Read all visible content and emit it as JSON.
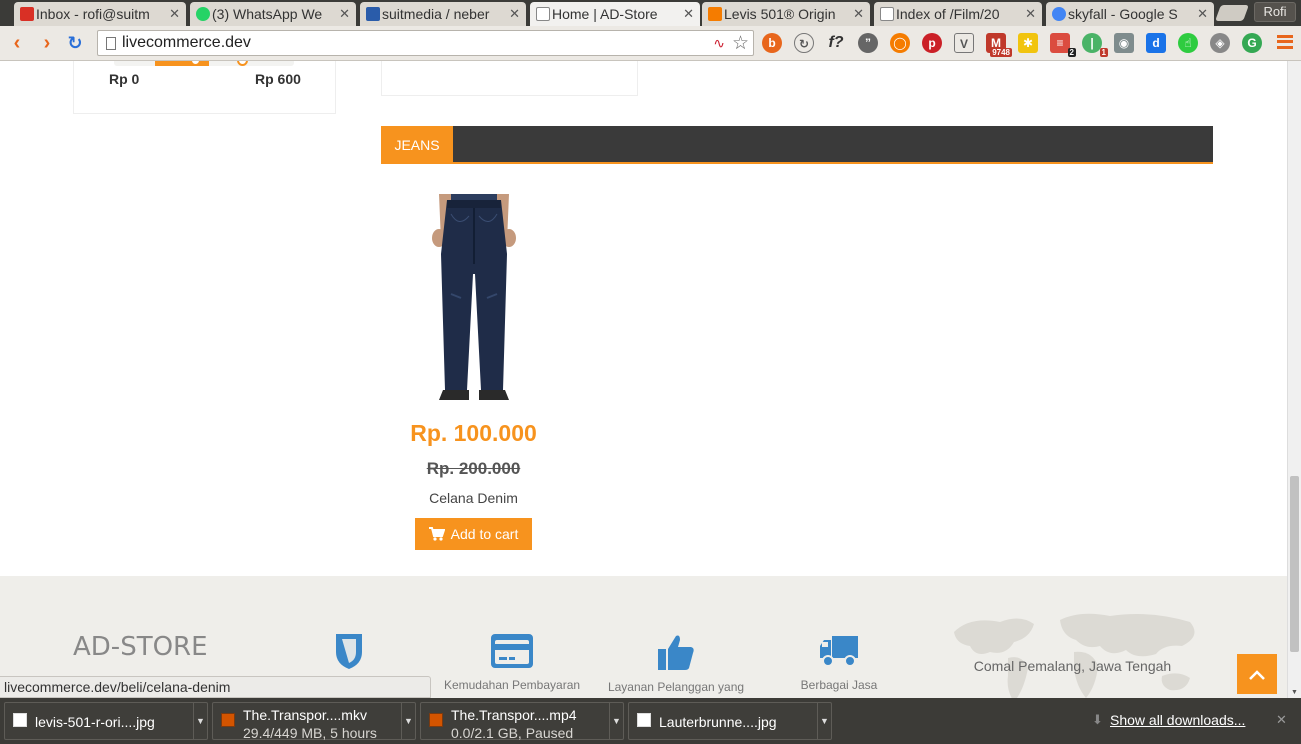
{
  "browser": {
    "tabs": [
      {
        "title": "Inbox - rofi@suitm",
        "favicon_color": "#d93025",
        "active": false
      },
      {
        "title": "(3) WhatsApp We",
        "favicon_color": "#25d366",
        "active": false
      },
      {
        "title": "suitmedia / neber",
        "favicon_color": "#2a5caa",
        "active": false
      },
      {
        "title": "Home | AD-Store",
        "favicon_color": "#cccccc",
        "active": true
      },
      {
        "title": "Levis 501® Origin",
        "favicon_color": "#f57c00",
        "active": false
      },
      {
        "title": "Index of /Film/20",
        "favicon_color": "#cccccc",
        "active": false
      },
      {
        "title": "skyfall - Google S",
        "favicon_color": "#4285f4",
        "active": false
      }
    ],
    "tab_close": "✕",
    "profile_name": "Rofi",
    "url": "livecommerce.dev",
    "extensions": [
      "lastpass-icon",
      "streak-icon",
      "formula-icon",
      "quote-icon",
      "firefox-icon",
      "pinterest-icon",
      "shield-icon",
      "gmail-checker-icon",
      "sticky-notes-icon",
      "todoist-icon",
      "pushbullet-icon",
      "camera-icon",
      "dictionary-icon",
      "hand-cursor-icon",
      "feedly-icon",
      "google-icon"
    ],
    "extension_badges": {
      "gmail": "9748",
      "todoist": "2",
      "pushbullet": "1"
    }
  },
  "page": {
    "price_filter": {
      "min_label": "Rp 0",
      "max_label": "Rp 600"
    },
    "category": {
      "label": "JEANS"
    },
    "product": {
      "price": "Rp. 100.000",
      "old_price": "Rp. 200.000",
      "name": "Celana Denim",
      "cart_label": "Add to cart"
    },
    "footer": {
      "logo": "AD-STORE",
      "features": [
        {
          "icon": "shield-icon",
          "label": ""
        },
        {
          "icon": "credit-card-icon",
          "label": "Kemudahan Pembayaran"
        },
        {
          "icon": "thumbs-up-icon",
          "label": "Layanan Pelanggan yang Responsif"
        },
        {
          "icon": "truck-icon",
          "label": "Berbagai Jasa Pengiriman"
        }
      ],
      "address": "Comal Pemalang, Jawa Tengah"
    },
    "status_url": "livecommerce.dev/beli/celana-denim"
  },
  "downloads": {
    "items": [
      {
        "name": "levis-501-r-ori....jpg",
        "sub": "",
        "type": "image"
      },
      {
        "name": "The.Transpor....mkv",
        "sub": "29.4/449 MB, 5 hours",
        "type": "video"
      },
      {
        "name": "The.Transpor....mp4",
        "sub": "0.0/2.1 GB, Paused",
        "type": "video"
      },
      {
        "name": "Lauterbrunne....jpg",
        "sub": "",
        "type": "image"
      }
    ],
    "show_all": "Show all downloads...",
    "close": "✕"
  },
  "colors": {
    "accent": "#f7931e",
    "dark": "#3a3a3a",
    "footer_bg": "#efeeea",
    "icon_blue": "#3a87c8"
  }
}
